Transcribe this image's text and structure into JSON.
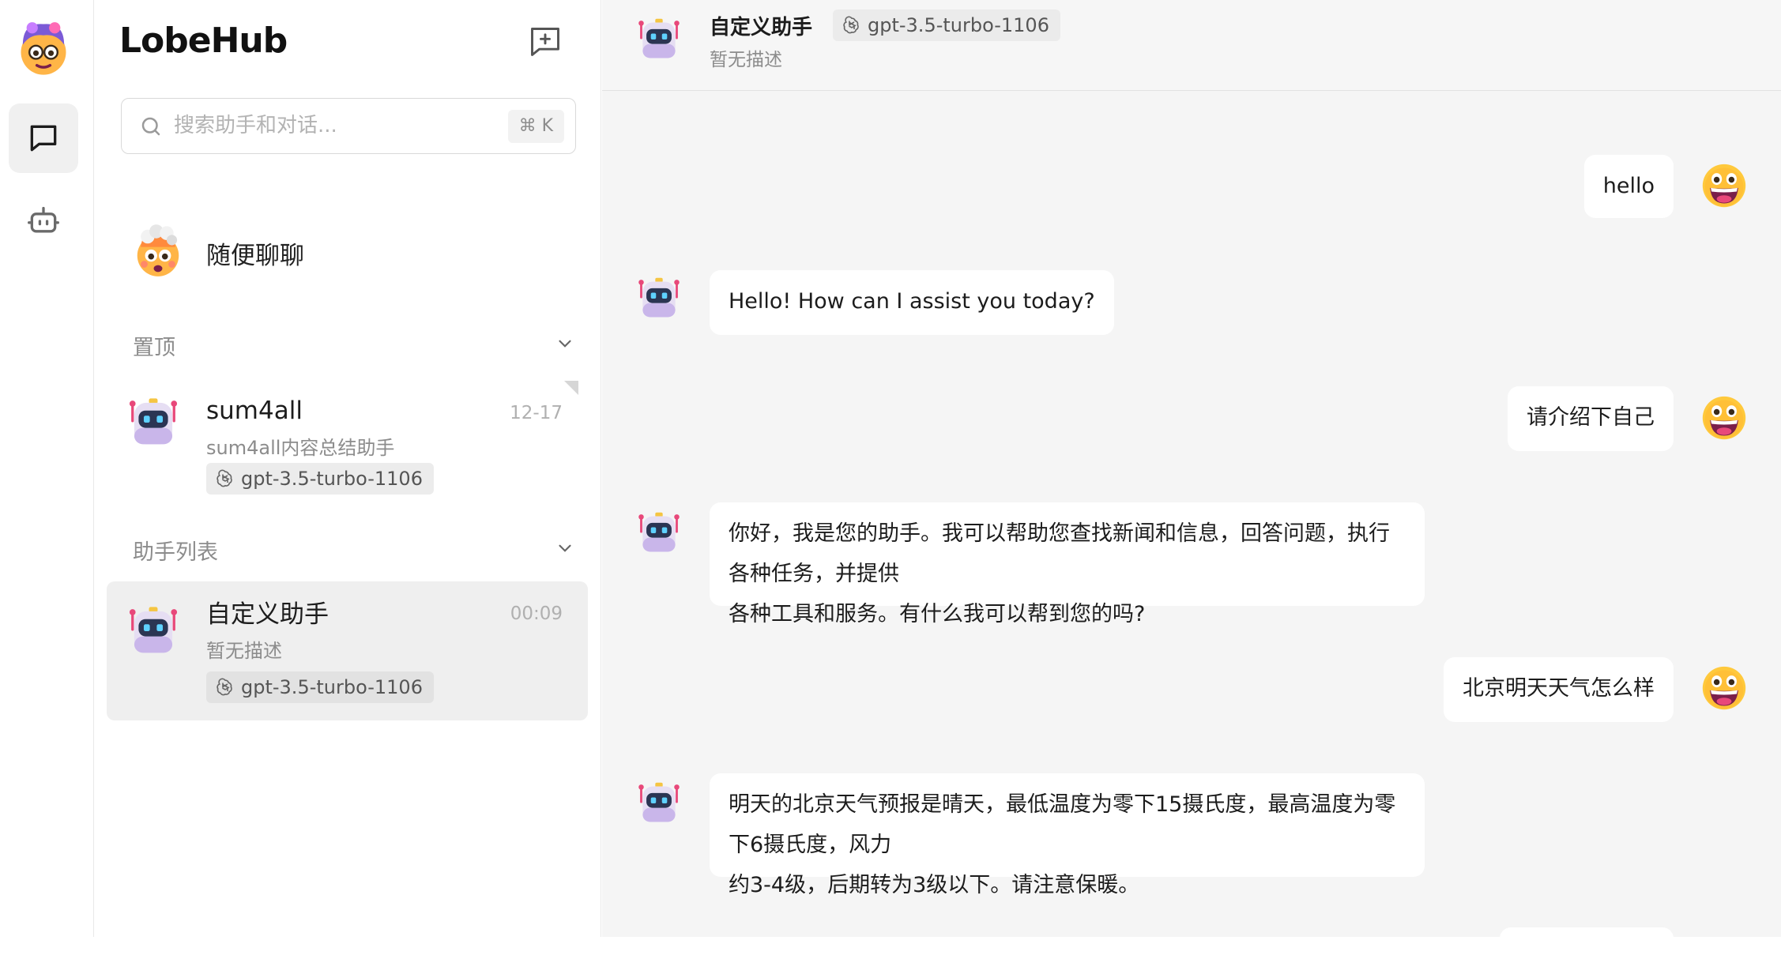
{
  "app": {
    "brand": "LobeHub"
  },
  "rail": {
    "items": [
      {
        "name": "chat",
        "icon": "message-square-icon",
        "active": true
      },
      {
        "name": "market",
        "icon": "bot-icon",
        "active": false
      }
    ]
  },
  "search": {
    "placeholder": "搜索助手和对话...",
    "shortcut": "⌘ K"
  },
  "random_chat": {
    "title": "随便聊聊"
  },
  "groups": {
    "pinned": {
      "label": "置顶"
    },
    "assistants": {
      "label": "助手列表"
    }
  },
  "sessions": {
    "pinned": [
      {
        "name": "sum4all",
        "desc": "sum4all内容总结助手",
        "time": "12-17",
        "model": "gpt-3.5-turbo-1106"
      }
    ],
    "list": [
      {
        "name": "自定义助手",
        "desc": "暂无描述",
        "time": "00:09",
        "model": "gpt-3.5-turbo-1106"
      }
    ]
  },
  "chat": {
    "title": "自定义助手",
    "subtitle": "暂无描述",
    "model": "gpt-3.5-turbo-1106",
    "messages": [
      {
        "role": "user",
        "text": "hello"
      },
      {
        "role": "assistant",
        "text": "Hello! How can I assist you today?"
      },
      {
        "role": "user",
        "text": "请介绍下自己"
      },
      {
        "role": "assistant",
        "line1": "你好，我是您的助手。我可以帮助您查找新闻和信息，回答问题，执行各种任务，并提供",
        "line2": "各种工具和服务。有什么我可以帮到您的吗?"
      },
      {
        "role": "user",
        "text": "北京明天天气怎么样"
      },
      {
        "role": "assistant",
        "line1": "明天的北京天气预报是晴天，最低温度为零下15摄氏度，最高温度为零下6摄氏度，风力",
        "line2": "约3-4级，后期转为3级以下。请注意保暖。"
      }
    ]
  },
  "colors": {
    "rail_bg": "#ffffff",
    "chat_bg": "#f5f5f5",
    "active_session_bg": "#efefef",
    "bubble_bg": "#ffffff",
    "muted_text": "#8c8c8c"
  }
}
